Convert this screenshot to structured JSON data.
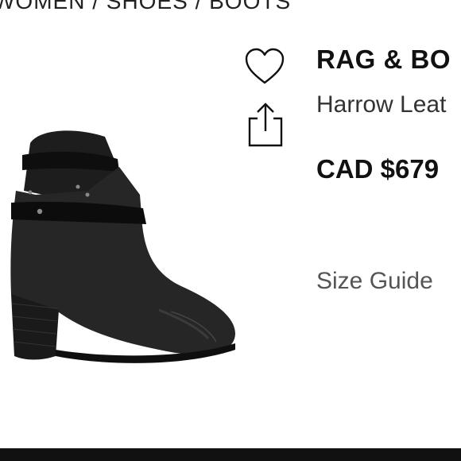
{
  "breadcrumb": "WOMEN / SHOES / BOOTS",
  "product": {
    "brand": "RAG & BO",
    "name": "Harrow Leat",
    "price": "CAD $679",
    "size_guide_label": "Size Guide",
    "image_alt": "Black leather ankle boot"
  },
  "icons": {
    "favorite": "heart-icon",
    "share": "share-icon"
  },
  "colors": {
    "text": "#111111",
    "bottom_bar": "#111111"
  }
}
